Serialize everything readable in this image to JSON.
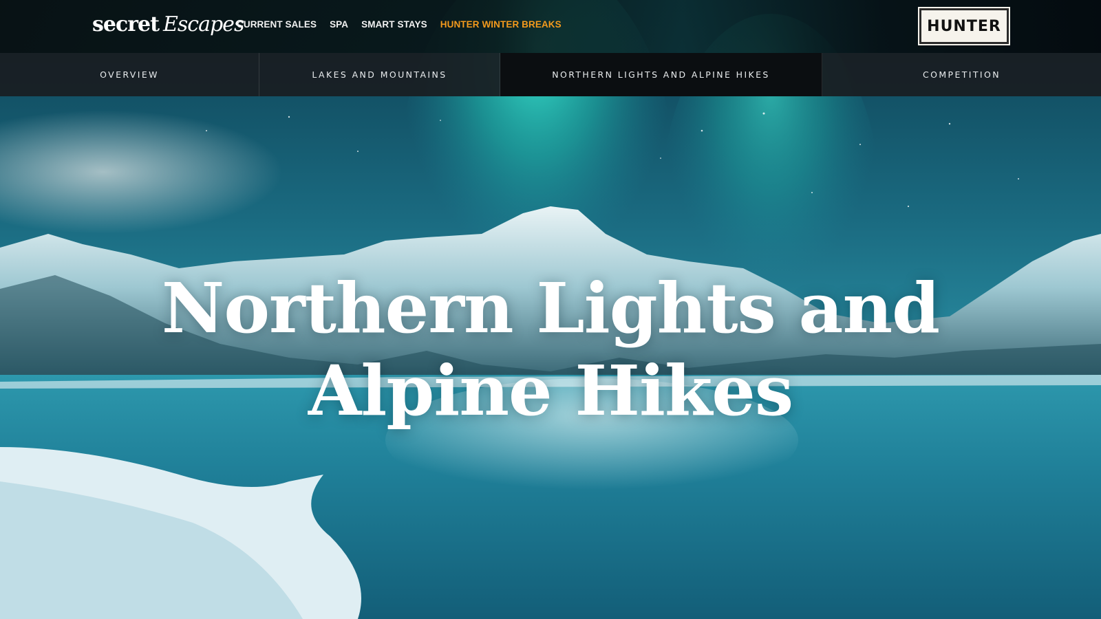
{
  "header": {
    "logo": {
      "word1": "secret",
      "word2": "Escapes"
    },
    "nav": [
      {
        "label": "CURRENT SALES",
        "active": false
      },
      {
        "label": "SPA",
        "active": false
      },
      {
        "label": "SMART STAYS",
        "active": false
      },
      {
        "label": "HUNTER WINTER BREAKS",
        "active": true
      }
    ],
    "partner_logo": "HUNTER",
    "accent_color": "#f39a1d"
  },
  "tabs": [
    {
      "label": "OVERVIEW",
      "active": false
    },
    {
      "label": "LAKES AND MOUNTAINS",
      "active": false
    },
    {
      "label": "NORTHERN LIGHTS AND ALPINE HIKES",
      "active": true
    },
    {
      "label": "COMPETITION",
      "active": false
    }
  ],
  "hero": {
    "headline_line1": "Northern Lights and",
    "headline_line2": "Alpine Hikes",
    "image_description_icon": "aurora-mountain-lake-image"
  }
}
